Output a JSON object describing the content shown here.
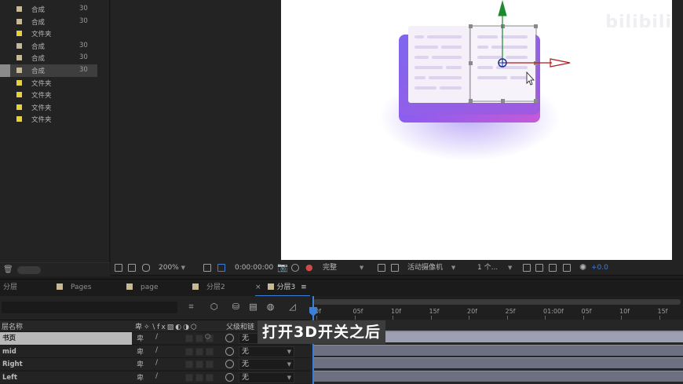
{
  "project": {
    "items": [
      {
        "name": "合成",
        "num": "30",
        "color": "#c8b894",
        "selected": false
      },
      {
        "name": "合成",
        "num": "30",
        "color": "#c8b894",
        "selected": false
      },
      {
        "name": "文件夹",
        "num": "",
        "color": "#e8d23b",
        "selected": false
      },
      {
        "name": "合成",
        "num": "30",
        "color": "#c8b894",
        "selected": false
      },
      {
        "name": "合成",
        "num": "30",
        "color": "#c8b894",
        "selected": false
      },
      {
        "name": "合成",
        "num": "30",
        "color": "#c8b894",
        "selected": true
      },
      {
        "name": "文件夹",
        "num": "",
        "color": "#e8d23b",
        "selected": false
      },
      {
        "name": "文件夹",
        "num": "",
        "color": "#e8d23b",
        "selected": false
      },
      {
        "name": "文件夹",
        "num": "",
        "color": "#e8d23b",
        "selected": false
      },
      {
        "name": "文件夹",
        "num": "",
        "color": "#e8d23b",
        "selected": false
      }
    ]
  },
  "viewer": {
    "watermark": "bilibili",
    "toolbar": {
      "zoom": "200%",
      "timecode": "0:00:00:00",
      "resolution": "完整",
      "camera": "活动摄像机",
      "views": "1 个...",
      "exposure": "+0.0"
    }
  },
  "tabs": [
    {
      "label": "分层",
      "active": false,
      "color": ""
    },
    {
      "label": "Pages",
      "active": false,
      "color": "#c8b894"
    },
    {
      "label": "page",
      "active": false,
      "color": "#c8b894"
    },
    {
      "label": "分层2",
      "active": false,
      "color": "#c8b894"
    },
    {
      "label": "分层3",
      "active": true,
      "color": "#c8b894",
      "close": "×",
      "menu": "≡"
    }
  ],
  "timeline": {
    "columns": {
      "layer_name": "层名称",
      "parent": "父级和链"
    },
    "ruler_ticks": [
      "0f",
      "05f",
      "10f",
      "15f",
      "20f",
      "25f",
      "01:00f",
      "05f",
      "10f",
      "15f"
    ],
    "layers": [
      {
        "name": "书页",
        "parent": "无",
        "selected": true
      },
      {
        "name": "mid",
        "parent": "无",
        "selected": false
      },
      {
        "name": "Right",
        "parent": "无",
        "selected": false
      },
      {
        "name": "Left",
        "parent": "无",
        "selected": false
      }
    ]
  },
  "subtitle": "打开3D开关之后",
  "colors": {
    "accent": "#3b7fd8",
    "book_purple": "#7a5ce8",
    "book_page": "#f3eef9",
    "x_axis": "#b31a1a",
    "y_axis": "#1e8a2e"
  }
}
